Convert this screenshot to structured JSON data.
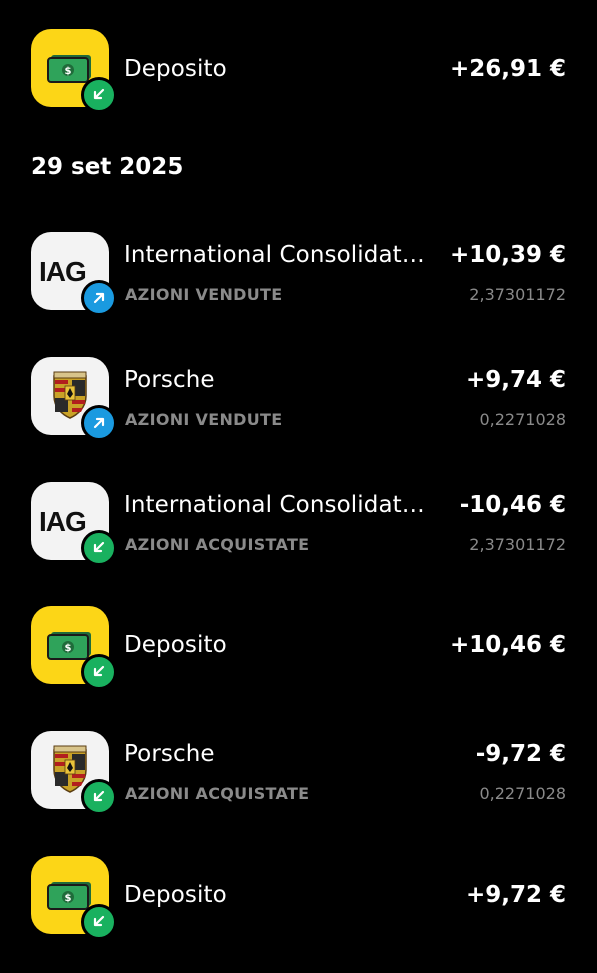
{
  "colors": {
    "background": "#000000",
    "deposit_tile": "#fcd617",
    "stock_tile": "#f3f3f3",
    "badge_in": "#19b15f",
    "badge_out": "#1a9ae0",
    "secondary_text": "#8a8a8a"
  },
  "date_header": "29 set 2025",
  "transactions": [
    {
      "icon": "cash-bill-icon",
      "badge": "arrow-down-left-icon",
      "title": "Deposito",
      "subtitle": "",
      "amount": "+26,91 €",
      "quantity": ""
    },
    {
      "icon": "iag-logo",
      "badge": "arrow-up-right-icon",
      "title": "International Consolidated Airlines Group",
      "subtitle": "AZIONI VENDUTE",
      "amount": "+10,39 €",
      "quantity": "2,37301172"
    },
    {
      "icon": "porsche-crest-icon",
      "badge": "arrow-up-right-icon",
      "title": "Porsche",
      "subtitle": "AZIONI VENDUTE",
      "amount": "+9,74 €",
      "quantity": "0,2271028"
    },
    {
      "icon": "iag-logo",
      "badge": "arrow-down-left-icon",
      "title": "International Consolidated Airlines Group",
      "subtitle": "AZIONI ACQUISTATE",
      "amount": "-10,46 €",
      "quantity": "2,37301172"
    },
    {
      "icon": "cash-bill-icon",
      "badge": "arrow-down-left-icon",
      "title": "Deposito",
      "subtitle": "",
      "amount": "+10,46 €",
      "quantity": ""
    },
    {
      "icon": "porsche-crest-icon",
      "badge": "arrow-down-left-icon",
      "title": "Porsche",
      "subtitle": "AZIONI ACQUISTATE",
      "amount": "-9,72 €",
      "quantity": "0,2271028"
    },
    {
      "icon": "cash-bill-icon",
      "badge": "arrow-down-left-icon",
      "title": "Deposito",
      "subtitle": "",
      "amount": "+9,72 €",
      "quantity": ""
    }
  ],
  "logo_text": {
    "iag": "IAG"
  }
}
